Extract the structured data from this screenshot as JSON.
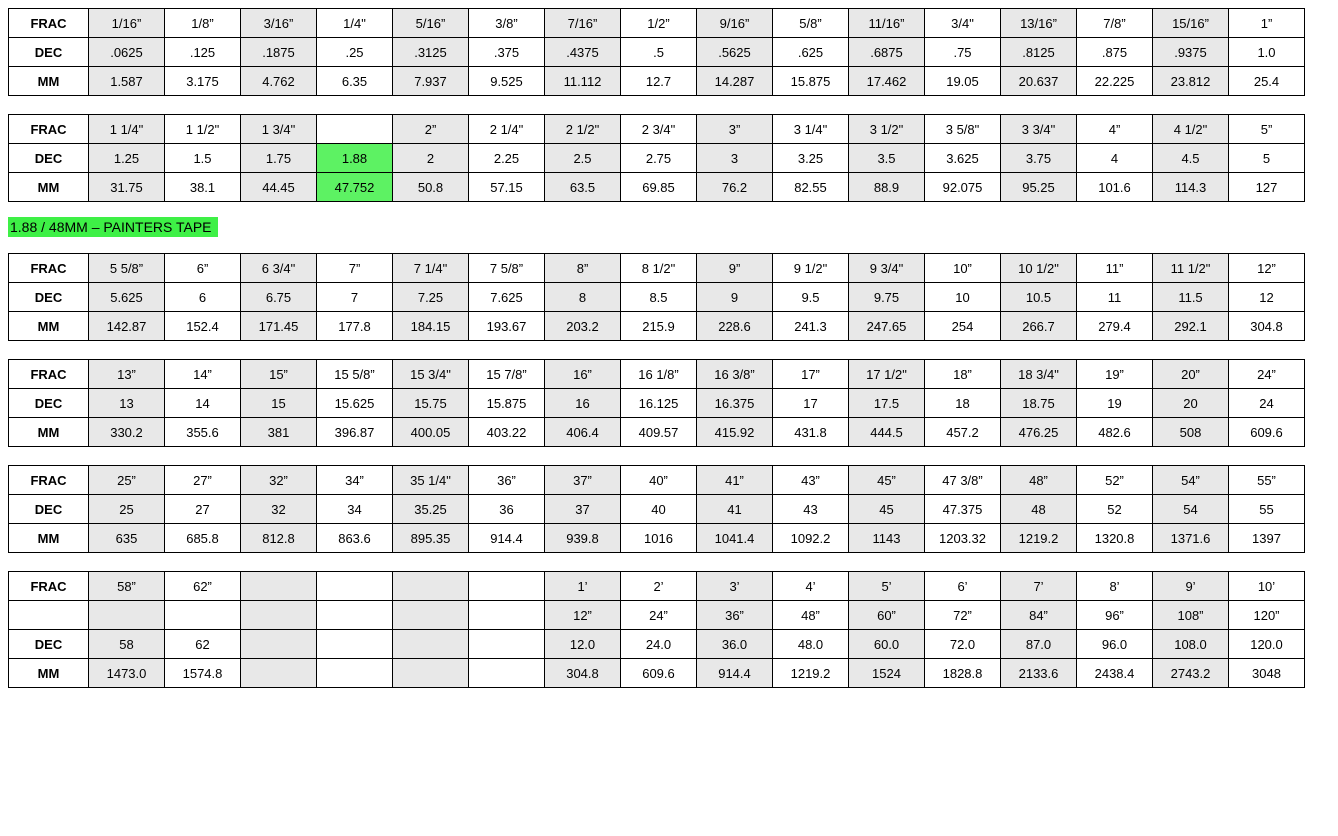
{
  "labels": {
    "frac": "FRAC",
    "dec": "DEC",
    "mm": "MM"
  },
  "note": "1.88  /  48MM – PAINTERS TAPE",
  "colWidths": {
    "label": 80,
    "data": 76
  },
  "tables": [
    {
      "rows": [
        {
          "label": "frac",
          "shaded": true,
          "cells": [
            "1/16”",
            "1/8”",
            "3/16”",
            "1/4\"",
            "5/16”",
            "3/8”",
            "7/16”",
            "1/2”",
            "9/16”",
            "5/8”",
            "11/16”",
            "3/4\"",
            "13/16”",
            "7/8”",
            "15/16”",
            "1”"
          ]
        },
        {
          "label": "dec",
          "shaded": true,
          "cells": [
            ".0625",
            ".125",
            ".1875",
            ".25",
            ".3125",
            ".375",
            ".4375",
            ".5",
            ".5625",
            ".625",
            ".6875",
            ".75",
            ".8125",
            ".875",
            ".9375",
            "1.0"
          ]
        },
        {
          "label": "mm",
          "shaded": true,
          "cells": [
            "1.587",
            "3.175",
            "4.762",
            "6.35",
            "7.937",
            "9.525",
            "11.112",
            "12.7",
            "14.287",
            "15.875",
            "17.462",
            "19.05",
            "20.637",
            "22.225",
            "23.812",
            "25.4"
          ]
        }
      ]
    },
    {
      "rows": [
        {
          "label": "frac",
          "shaded": true,
          "cells": [
            "1 1/4\"",
            "1 1/2\"",
            "1 3/4\"",
            "",
            "2”",
            "2 1/4\"",
            "2 1/2\"",
            "2 3/4\"",
            "3”",
            "3 1/4\"",
            "3 1/2\"",
            "3 5/8\"",
            "3 3/4\"",
            "4”",
            "4 1/2\"",
            "5”"
          ]
        },
        {
          "label": "dec",
          "shaded": true,
          "cells": [
            "1.25",
            "1.5",
            "1.75",
            {
              "v": "1.88",
              "green": true
            },
            "2",
            "2.25",
            "2.5",
            "2.75",
            "3",
            "3.25",
            "3.5",
            "3.625",
            "3.75",
            "4",
            "4.5",
            "5"
          ]
        },
        {
          "label": "mm",
          "shaded": true,
          "cells": [
            "31.75",
            "38.1",
            "44.45",
            {
              "v": "47.752",
              "green": true
            },
            "50.8",
            "57.15",
            "63.5",
            "69.85",
            "76.2",
            "82.55",
            "88.9",
            "92.075",
            "95.25",
            "101.6",
            "114.3",
            "127"
          ]
        }
      ],
      "noteAfter": true
    },
    {
      "rows": [
        {
          "label": "frac",
          "shaded": true,
          "cells": [
            "5 5/8”",
            "6”",
            "6 3/4\"",
            "7”",
            "7 1/4\"",
            "7 5/8”",
            "8”",
            "8 1/2\"",
            "9”",
            "9 1/2\"",
            "9 3/4\"",
            "10”",
            "10 1/2\"",
            "11”",
            "11 1/2\"",
            "12”"
          ]
        },
        {
          "label": "dec",
          "shaded": true,
          "cells": [
            "5.625",
            "6",
            "6.75",
            "7",
            "7.25",
            "7.625",
            "8",
            "8.5",
            "9",
            "9.5",
            "9.75",
            "10",
            "10.5",
            "11",
            "11.5",
            "12"
          ]
        },
        {
          "label": "mm",
          "shaded": true,
          "cells": [
            "142.87",
            "152.4",
            "171.45",
            "177.8",
            "184.15",
            "193.67",
            "203.2",
            "215.9",
            "228.6",
            "241.3",
            "247.65",
            "254",
            "266.7",
            "279.4",
            "292.1",
            "304.8"
          ]
        }
      ]
    },
    {
      "rows": [
        {
          "label": "frac",
          "shaded": true,
          "cells": [
            "13”",
            "14”",
            "15”",
            "15 5/8”",
            "15 3/4\"",
            "15 7/8”",
            "16”",
            "16 1/8”",
            "16 3/8”",
            "17”",
            "17 1/2\"",
            "18”",
            "18 3/4\"",
            "19”",
            "20”",
            "24”"
          ]
        },
        {
          "label": "dec",
          "shaded": true,
          "cells": [
            "13",
            "14",
            "15",
            "15.625",
            "15.75",
            "15.875",
            "16",
            "16.125",
            "16.375",
            "17",
            "17.5",
            "18",
            "18.75",
            "19",
            "20",
            "24"
          ]
        },
        {
          "label": "mm",
          "shaded": true,
          "cells": [
            "330.2",
            "355.6",
            "381",
            "396.87",
            "400.05",
            "403.22",
            "406.4",
            "409.57",
            "415.92",
            "431.8",
            "444.5",
            "457.2",
            "476.25",
            "482.6",
            "508",
            "609.6"
          ]
        }
      ]
    },
    {
      "rows": [
        {
          "label": "frac",
          "shaded": true,
          "cells": [
            "25”",
            "27”",
            "32”",
            "34”",
            "35 1/4\"",
            "36”",
            "37”",
            "40”",
            "41”",
            "43”",
            "45”",
            "47 3/8”",
            "48”",
            "52”",
            "54”",
            "55”"
          ]
        },
        {
          "label": "dec",
          "shaded": true,
          "cells": [
            "25",
            "27",
            "32",
            "34",
            "35.25",
            "36",
            "37",
            "40",
            "41",
            "43",
            "45",
            "47.375",
            "48",
            "52",
            "54",
            "55"
          ]
        },
        {
          "label": "mm",
          "shaded": true,
          "cells": [
            "635",
            "685.8",
            "812.8",
            "863.6",
            "895.35",
            "914.4",
            "939.8",
            "1016",
            "1041.4",
            "1092.2",
            "1143",
            "1203.32",
            "1219.2",
            "1320.8",
            "1371.6",
            "1397"
          ]
        }
      ]
    },
    {
      "rows": [
        {
          "label": "frac",
          "shaded": true,
          "cells": [
            "58”",
            "62”",
            "",
            "",
            "",
            "",
            "1’",
            "2’",
            "3’",
            "4’",
            "5’",
            "6’",
            "7’",
            "8’",
            "9’",
            "10’"
          ]
        },
        {
          "label": "",
          "shaded": true,
          "cells": [
            "",
            "",
            "",
            "",
            "",
            "",
            "12”",
            "24”",
            "36”",
            "48”",
            "60”",
            "72”",
            "84”",
            "96”",
            "108”",
            "120”"
          ]
        },
        {
          "label": "dec",
          "shaded": true,
          "cells": [
            "58",
            "62",
            "",
            "",
            "",
            "",
            "12.0",
            "24.0",
            "36.0",
            "48.0",
            "60.0",
            "72.0",
            "87.0",
            "96.0",
            "108.0",
            "120.0"
          ]
        },
        {
          "label": "mm",
          "shaded": true,
          "cells": [
            "1473.0",
            "1574.8",
            "",
            "",
            "",
            "",
            "304.8",
            "609.6",
            "914.4",
            "1219.2",
            "1524",
            "1828.8",
            "2133.6",
            "2438.4",
            "2743.2",
            "3048"
          ]
        }
      ]
    }
  ]
}
